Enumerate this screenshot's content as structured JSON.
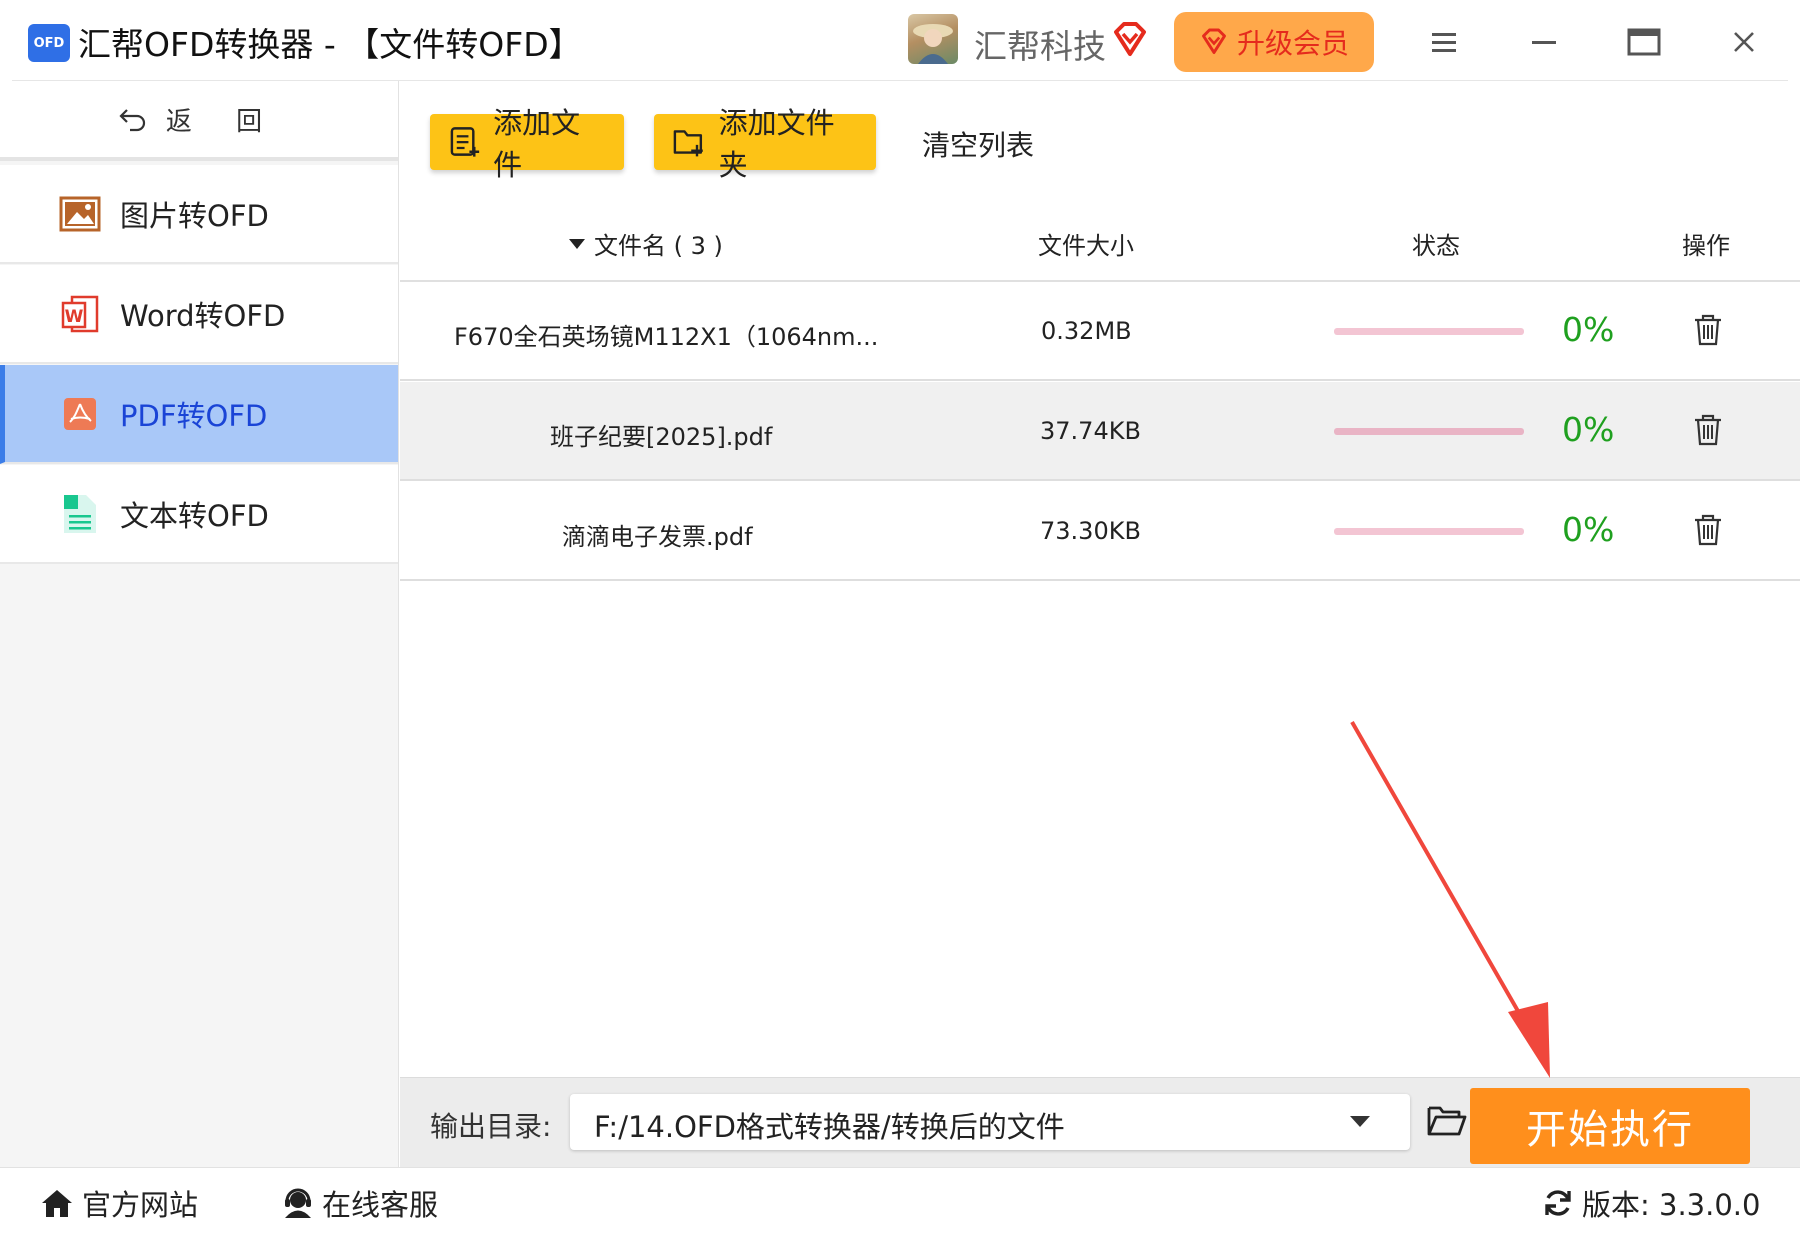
{
  "window": {
    "logo_text": "OFD",
    "title": "汇帮OFD转换器 - 【文件转OFD】",
    "company": "汇帮科技",
    "upgrade_label": "升级会员"
  },
  "sidebar": {
    "back_label": "返 回",
    "items": [
      {
        "label": "图片转OFD",
        "icon": "image-icon",
        "active": false
      },
      {
        "label": "Word转OFD",
        "icon": "word-icon",
        "active": false
      },
      {
        "label": "PDF转OFD",
        "icon": "pdf-icon",
        "active": true
      },
      {
        "label": "文本转OFD",
        "icon": "text-file-icon",
        "active": false
      }
    ]
  },
  "toolbar": {
    "add_file": "添加文件",
    "add_folder": "添加文件夹",
    "clear_list": "清空列表"
  },
  "table": {
    "headers": {
      "name": "文件名 ( 3 )",
      "size": "文件大小",
      "status": "状态",
      "action": "操作"
    },
    "rows": [
      {
        "name": "F670全石英场镜M112X1（1064nm...",
        "size": "0.32MB",
        "progress": "0%"
      },
      {
        "name": "班子纪要[2025].pdf",
        "size": "37.74KB",
        "progress": "0%"
      },
      {
        "name": "滴滴电子发票.pdf",
        "size": "73.30KB",
        "progress": "0%"
      }
    ]
  },
  "output": {
    "label": "输出目录:",
    "path": "F:/14.OFD格式转换器/转换后的文件",
    "start_label": "开始执行"
  },
  "footer": {
    "website": "官方网站",
    "support": "在线客服",
    "version": "版本:  3.3.0.0"
  },
  "colors": {
    "accent_yellow": "#fdc316",
    "start_orange": "#ff8f1c",
    "active_nav": "#a9c8f8",
    "progress_green": "#1fa01f",
    "arrow_red": "#f0473c"
  }
}
